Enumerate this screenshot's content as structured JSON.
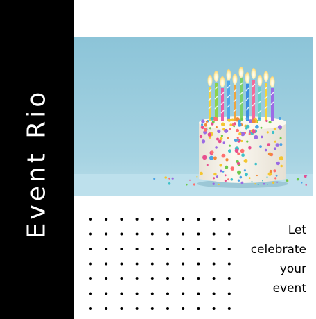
{
  "brand": {
    "name": "Event Rio"
  },
  "hero_image": {
    "subject": "birthday-cake-with-candles",
    "background_color": "#9fcadb",
    "frosting_color": "#f7f3ea"
  },
  "tagline": {
    "lines": [
      "Let",
      "celebrate",
      "your",
      "event"
    ]
  },
  "colors": {
    "sidebar": "#000000",
    "text_on_sidebar": "#ffffff",
    "text": "#000000",
    "background": "#ffffff"
  }
}
